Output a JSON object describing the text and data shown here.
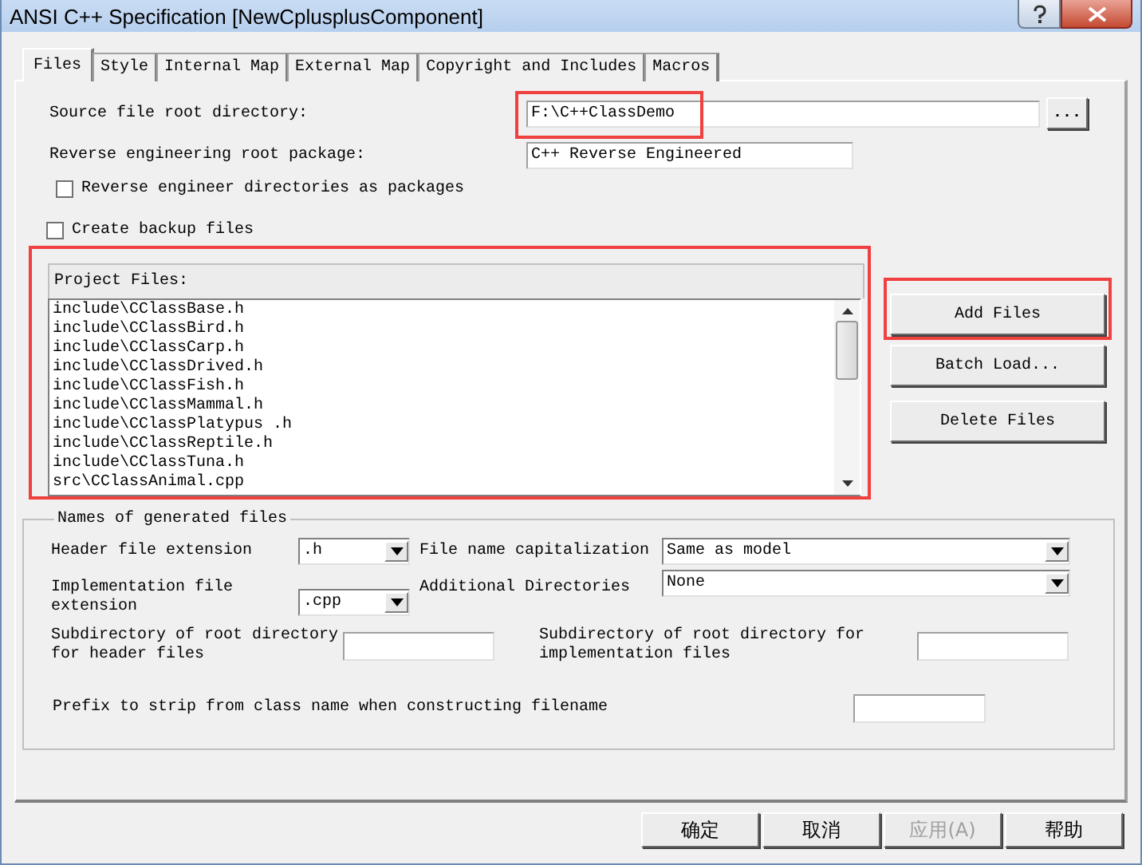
{
  "window": {
    "title": "ANSI C++ Specification [NewCplusplusComponent]"
  },
  "tabs": [
    {
      "label": "Files",
      "selected": true
    },
    {
      "label": "Style",
      "selected": false
    },
    {
      "label": "Internal Map",
      "selected": false
    },
    {
      "label": "External Map",
      "selected": false
    },
    {
      "label": "Copyright and Includes",
      "selected": false
    },
    {
      "label": "Macros",
      "selected": false
    }
  ],
  "source_root": {
    "label": "Source file root directory:",
    "value": "F:\\C++ClassDemo",
    "highlighted": true,
    "browse": "..."
  },
  "reverse_package": {
    "label": "Reverse engineering root package:",
    "value": "C++ Reverse Engineered"
  },
  "checkboxes": [
    {
      "label": "Reverse engineer directories as packages",
      "checked": false
    },
    {
      "label": "Create backup files",
      "checked": false
    }
  ],
  "project_files": {
    "label": "Project Files:",
    "highlighted": true,
    "items": [
      "include\\CClassBase.h",
      "include\\CClassBird.h",
      "include\\CClassCarp.h",
      "include\\CClassDrived.h",
      "include\\CClassFish.h",
      "include\\CClassMammal.h",
      "include\\CClassPlatypus .h",
      "include\\CClassReptile.h",
      "include\\CClassTuna.h",
      "src\\CClassAnimal.cpp"
    ]
  },
  "file_buttons": [
    {
      "label": "Add Files",
      "highlighted": true
    },
    {
      "label": "Batch Load...",
      "highlighted": false
    },
    {
      "label": "Delete Files",
      "highlighted": false
    }
  ],
  "names_group": {
    "title": "Names of generated files",
    "header_ext": {
      "label": "Header file extension",
      "value": ".h"
    },
    "capitalization": {
      "label": "File name capitalization",
      "value": "Same as model"
    },
    "impl_ext": {
      "label": "Implementation file extension",
      "value": ".cpp"
    },
    "additional_dirs": {
      "label": "Additional Directories",
      "value": "None"
    },
    "header_subdir": {
      "label": "Subdirectory of root directory for header files"
    },
    "impl_subdir": {
      "label": "Subdirectory of root directory for implementation files"
    },
    "prefix": {
      "label": "Prefix to strip from class name when constructing filename"
    }
  },
  "buttons": [
    {
      "label": "确定",
      "disabled": false
    },
    {
      "label": "取消",
      "disabled": false
    },
    {
      "label": "应用(A)",
      "disabled": true
    },
    {
      "label": "帮助",
      "disabled": false
    }
  ]
}
